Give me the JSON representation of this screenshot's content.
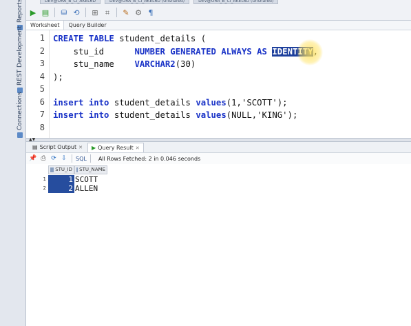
{
  "rail": {
    "items": [
      {
        "label": "Reports",
        "icon": "reports-icon"
      },
      {
        "label": "REST Development",
        "icon": "rest-icon"
      },
      {
        "label": "Connections",
        "icon": "connections-icon"
      }
    ]
  },
  "connection_tabs": [
    "DEV@ORA_B_CI_AKEL6D",
    "DEV@ORA_B_CI_AKEL6D (Unshared)",
    "DEV@ORA_B_CI_AKEL6D (Unshared)"
  ],
  "toolbar": {
    "buttons": [
      {
        "name": "run-statement-button",
        "glyph": "▶"
      },
      {
        "name": "run-script-button",
        "glyph": "▤"
      },
      {
        "name": "commit-button",
        "glyph": "⛁"
      },
      {
        "name": "rollback-button",
        "glyph": "⟲"
      },
      {
        "name": "explain-plan-button",
        "glyph": "⊞"
      },
      {
        "name": "autotrace-button",
        "glyph": "⌗"
      },
      {
        "name": "clear-button",
        "glyph": "✎"
      },
      {
        "name": "sql-tuning-button",
        "glyph": "⚙"
      },
      {
        "name": "format-button",
        "glyph": "¶"
      }
    ]
  },
  "subtabs": [
    "Worksheet",
    "Query Builder"
  ],
  "editor": {
    "line_numbers": [
      "1",
      "2",
      "3",
      "4",
      "5",
      "6",
      "7",
      "8"
    ],
    "lines": [
      [
        {
          "t": "kw",
          "v": "CREATE TABLE "
        },
        {
          "t": "id",
          "v": "student_details ("
        }
      ],
      [
        {
          "t": "id",
          "v": "    stu_id      "
        },
        {
          "t": "kw",
          "v": "NUMBER GENERATED ALWAYS AS "
        },
        {
          "t": "hl",
          "v": "IDENTITY"
        },
        {
          "t": "id",
          "v": ","
        }
      ],
      [
        {
          "t": "id",
          "v": "    stu_name    "
        },
        {
          "t": "kw",
          "v": "VARCHAR2"
        },
        {
          "t": "id",
          "v": "(30)"
        }
      ],
      [
        {
          "t": "id",
          "v": ");"
        }
      ],
      [],
      [
        {
          "t": "kw",
          "v": "insert into "
        },
        {
          "t": "id",
          "v": "student_details "
        },
        {
          "t": "kw",
          "v": "values"
        },
        {
          "t": "id",
          "v": "(1,'SCOTT');"
        }
      ],
      [
        {
          "t": "kw",
          "v": "insert into "
        },
        {
          "t": "id",
          "v": "student_details "
        },
        {
          "t": "kw",
          "v": "values"
        },
        {
          "t": "id",
          "v": "(NULL,'KING');"
        }
      ],
      []
    ]
  },
  "output": {
    "tabs": [
      {
        "label": "Script Output",
        "active": false
      },
      {
        "label": "Query Result",
        "active": true
      }
    ],
    "sql_label": "SQL",
    "status": "All Rows Fetched: 2 in 0.046 seconds",
    "columns": [
      "STU_ID",
      "STU_NAME"
    ],
    "rows": [
      {
        "n": "1",
        "id": "1",
        "name": "SCOTT"
      },
      {
        "n": "2",
        "id": "2",
        "name": "ALLEN"
      }
    ]
  },
  "colors": {
    "keyword": "#1a33c7",
    "selection": "#1d3f9c",
    "cell_selected": "#264d9e"
  }
}
